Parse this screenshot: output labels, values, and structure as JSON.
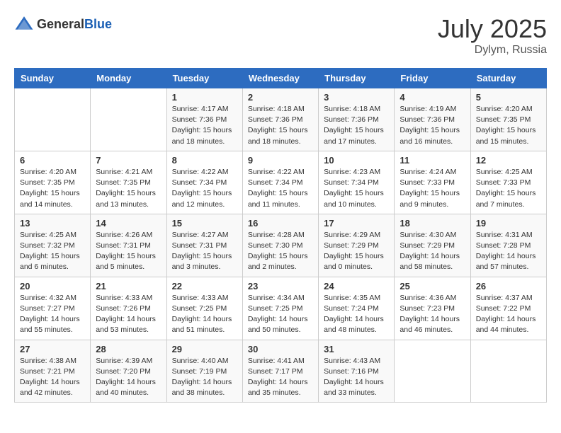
{
  "header": {
    "logo_general": "General",
    "logo_blue": "Blue",
    "month_year": "July 2025",
    "location": "Dylym, Russia"
  },
  "calendar": {
    "days_of_week": [
      "Sunday",
      "Monday",
      "Tuesday",
      "Wednesday",
      "Thursday",
      "Friday",
      "Saturday"
    ],
    "weeks": [
      [
        {
          "day": "",
          "info": ""
        },
        {
          "day": "",
          "info": ""
        },
        {
          "day": "1",
          "info": "Sunrise: 4:17 AM\nSunset: 7:36 PM\nDaylight: 15 hours and 18 minutes."
        },
        {
          "day": "2",
          "info": "Sunrise: 4:18 AM\nSunset: 7:36 PM\nDaylight: 15 hours and 18 minutes."
        },
        {
          "day": "3",
          "info": "Sunrise: 4:18 AM\nSunset: 7:36 PM\nDaylight: 15 hours and 17 minutes."
        },
        {
          "day": "4",
          "info": "Sunrise: 4:19 AM\nSunset: 7:36 PM\nDaylight: 15 hours and 16 minutes."
        },
        {
          "day": "5",
          "info": "Sunrise: 4:20 AM\nSunset: 7:35 PM\nDaylight: 15 hours and 15 minutes."
        }
      ],
      [
        {
          "day": "6",
          "info": "Sunrise: 4:20 AM\nSunset: 7:35 PM\nDaylight: 15 hours and 14 minutes."
        },
        {
          "day": "7",
          "info": "Sunrise: 4:21 AM\nSunset: 7:35 PM\nDaylight: 15 hours and 13 minutes."
        },
        {
          "day": "8",
          "info": "Sunrise: 4:22 AM\nSunset: 7:34 PM\nDaylight: 15 hours and 12 minutes."
        },
        {
          "day": "9",
          "info": "Sunrise: 4:22 AM\nSunset: 7:34 PM\nDaylight: 15 hours and 11 minutes."
        },
        {
          "day": "10",
          "info": "Sunrise: 4:23 AM\nSunset: 7:34 PM\nDaylight: 15 hours and 10 minutes."
        },
        {
          "day": "11",
          "info": "Sunrise: 4:24 AM\nSunset: 7:33 PM\nDaylight: 15 hours and 9 minutes."
        },
        {
          "day": "12",
          "info": "Sunrise: 4:25 AM\nSunset: 7:33 PM\nDaylight: 15 hours and 7 minutes."
        }
      ],
      [
        {
          "day": "13",
          "info": "Sunrise: 4:25 AM\nSunset: 7:32 PM\nDaylight: 15 hours and 6 minutes."
        },
        {
          "day": "14",
          "info": "Sunrise: 4:26 AM\nSunset: 7:31 PM\nDaylight: 15 hours and 5 minutes."
        },
        {
          "day": "15",
          "info": "Sunrise: 4:27 AM\nSunset: 7:31 PM\nDaylight: 15 hours and 3 minutes."
        },
        {
          "day": "16",
          "info": "Sunrise: 4:28 AM\nSunset: 7:30 PM\nDaylight: 15 hours and 2 minutes."
        },
        {
          "day": "17",
          "info": "Sunrise: 4:29 AM\nSunset: 7:29 PM\nDaylight: 15 hours and 0 minutes."
        },
        {
          "day": "18",
          "info": "Sunrise: 4:30 AM\nSunset: 7:29 PM\nDaylight: 14 hours and 58 minutes."
        },
        {
          "day": "19",
          "info": "Sunrise: 4:31 AM\nSunset: 7:28 PM\nDaylight: 14 hours and 57 minutes."
        }
      ],
      [
        {
          "day": "20",
          "info": "Sunrise: 4:32 AM\nSunset: 7:27 PM\nDaylight: 14 hours and 55 minutes."
        },
        {
          "day": "21",
          "info": "Sunrise: 4:33 AM\nSunset: 7:26 PM\nDaylight: 14 hours and 53 minutes."
        },
        {
          "day": "22",
          "info": "Sunrise: 4:33 AM\nSunset: 7:25 PM\nDaylight: 14 hours and 51 minutes."
        },
        {
          "day": "23",
          "info": "Sunrise: 4:34 AM\nSunset: 7:25 PM\nDaylight: 14 hours and 50 minutes."
        },
        {
          "day": "24",
          "info": "Sunrise: 4:35 AM\nSunset: 7:24 PM\nDaylight: 14 hours and 48 minutes."
        },
        {
          "day": "25",
          "info": "Sunrise: 4:36 AM\nSunset: 7:23 PM\nDaylight: 14 hours and 46 minutes."
        },
        {
          "day": "26",
          "info": "Sunrise: 4:37 AM\nSunset: 7:22 PM\nDaylight: 14 hours and 44 minutes."
        }
      ],
      [
        {
          "day": "27",
          "info": "Sunrise: 4:38 AM\nSunset: 7:21 PM\nDaylight: 14 hours and 42 minutes."
        },
        {
          "day": "28",
          "info": "Sunrise: 4:39 AM\nSunset: 7:20 PM\nDaylight: 14 hours and 40 minutes."
        },
        {
          "day": "29",
          "info": "Sunrise: 4:40 AM\nSunset: 7:19 PM\nDaylight: 14 hours and 38 minutes."
        },
        {
          "day": "30",
          "info": "Sunrise: 4:41 AM\nSunset: 7:17 PM\nDaylight: 14 hours and 35 minutes."
        },
        {
          "day": "31",
          "info": "Sunrise: 4:43 AM\nSunset: 7:16 PM\nDaylight: 14 hours and 33 minutes."
        },
        {
          "day": "",
          "info": ""
        },
        {
          "day": "",
          "info": ""
        }
      ]
    ]
  }
}
